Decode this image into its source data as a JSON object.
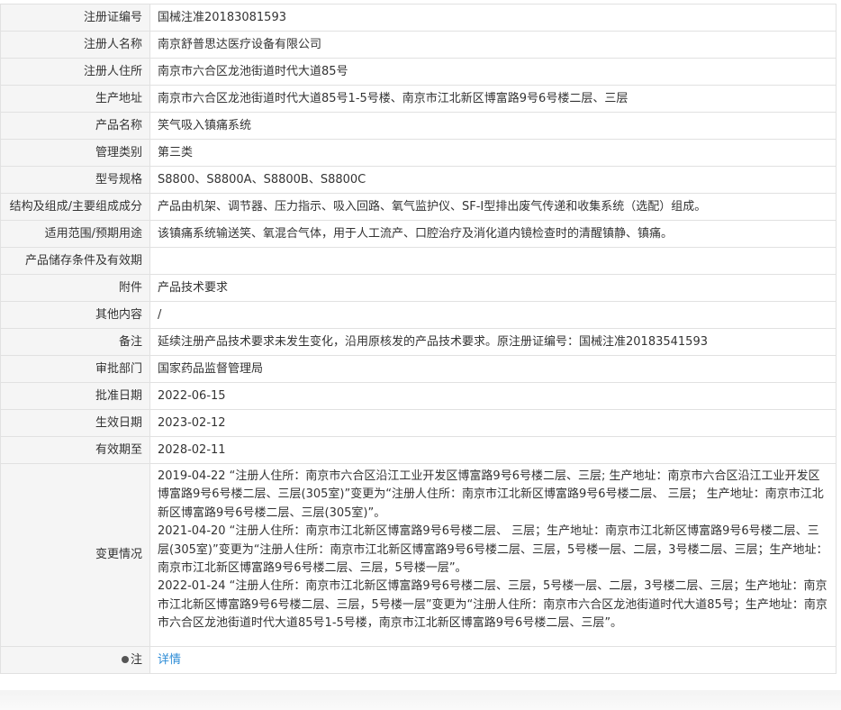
{
  "rows": [
    {
      "label": "注册证编号",
      "value": "国械注准20183081593"
    },
    {
      "label": "注册人名称",
      "value": "南京舒普思达医疗设备有限公司"
    },
    {
      "label": "注册人住所",
      "value": "南京市六合区龙池街道时代大道85号"
    },
    {
      "label": "生产地址",
      "value": "南京市六合区龙池街道时代大道85号1-5号楼、南京市江北新区博富路9号6号楼二层、三层"
    },
    {
      "label": "产品名称",
      "value": "笑气吸入镇痛系统"
    },
    {
      "label": "管理类别",
      "value": "第三类"
    },
    {
      "label": "型号规格",
      "value": "S8800、S8800A、S8800B、S8800C"
    },
    {
      "label": "结构及组成/主要组成成分",
      "value": "产品由机架、调节器、压力指示、吸入回路、氧气监护仪、SF-Ⅰ型排出废气传递和收集系统（选配）组成。"
    },
    {
      "label": "适用范围/预期用途",
      "value": "该镇痛系统输送笑、氧混合气体，用于人工流产、口腔治疗及消化道内镜检查时的清醒镇静、镇痛。"
    },
    {
      "label": "产品储存条件及有效期",
      "value": ""
    },
    {
      "label": "附件",
      "value": "产品技术要求"
    },
    {
      "label": "其他内容",
      "value": "/"
    },
    {
      "label": "备注",
      "value": "延续注册产品技术要求未发生变化，沿用原核发的产品技术要求。原注册证编号：国械注准20183541593"
    },
    {
      "label": "审批部门",
      "value": "国家药品监督管理局"
    },
    {
      "label": "批准日期",
      "value": "2022-06-15"
    },
    {
      "label": "生效日期",
      "value": "2023-02-12"
    },
    {
      "label": "有效期至",
      "value": "2028-02-11"
    }
  ],
  "changes": {
    "label": "变更情况",
    "entries": [
      "2019-04-22 “注册人住所：南京市六合区沿江工业开发区博富路9号6号楼二层、三层; 生产地址：南京市六合区沿江工业开发区博富路9号6号楼二层、三层(305室)”变更为“注册人住所：南京市江北新区博富路9号6号楼二层、 三层； 生产地址：南京市江北新区博富路9号6号楼二层、三层(305室)”。",
      "2021-04-20 “注册人住所：南京市江北新区博富路9号6号楼二层、 三层；生产地址：南京市江北新区博富路9号6号楼二层、三层(305室)”变更为“注册人住所：南京市江北新区博富路9号6号楼二层、三层，5号楼一层、二层，3号楼二层、三层；生产地址：南京市江北新区博富路9号6号楼二层、三层，5号楼一层”。",
      "2022-01-24 “注册人住所：南京市江北新区博富路9号6号楼二层、三层，5号楼一层、二层，3号楼二层、三层；生产地址：南京市江北新区博富路9号6号楼二层、三层，5号楼一层”变更为“注册人住所：南京市六合区龙池街道时代大道85号；生产地址：南京市六合区龙池街道时代大道85号1-5号楼，南京市江北新区博富路9号6号楼二层、三层”。"
    ]
  },
  "note": {
    "icon": "lightbulb-icon",
    "label": "注",
    "link_text": "详情",
    "link_color": "#2d8cd6"
  }
}
